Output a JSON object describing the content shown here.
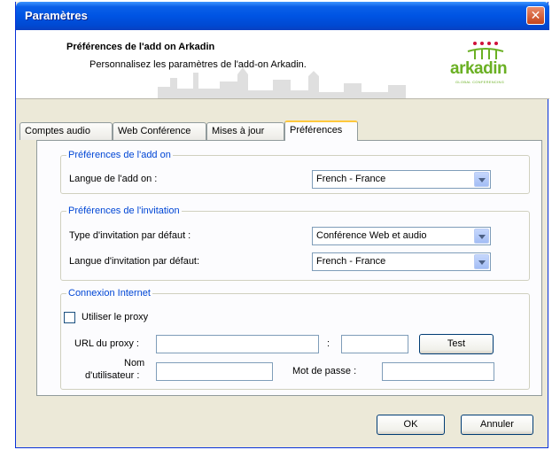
{
  "window": {
    "title": "Paramètres",
    "close_glyph": "✕"
  },
  "header": {
    "title": "Préférences de l'add on Arkadin",
    "subtitle": "Personnalisez les paramètres de l'add-on Arkadin.",
    "logo_text": "arkadin",
    "logo_tagline": "GLOBAL CONFERENCING",
    "logo_color": "#6ab023"
  },
  "tabs": [
    {
      "label": "Comptes audio"
    },
    {
      "label": "Web Conférence"
    },
    {
      "label": "Mises à jour"
    },
    {
      "label": "Préférences",
      "active": true
    }
  ],
  "addon": {
    "legend": "Préférences de l'add on",
    "language_label": "Langue de l'add on :",
    "language_value": "French - France"
  },
  "invitation": {
    "legend": "Préférences de l'invitation",
    "type_label": "Type d'invitation par défaut :",
    "type_value": "Conférence Web et audio",
    "language_label": "Langue d'invitation par défaut:",
    "language_value": "French - France"
  },
  "internet": {
    "legend": "Connexion Internet",
    "use_proxy_label": "Utiliser le proxy",
    "use_proxy_checked": false,
    "proxy_url_label": "URL du proxy :",
    "proxy_url_value": "",
    "port_separator": ":",
    "port_value": "",
    "test_button": "Test",
    "username_label_line1": "Nom",
    "username_label_line2": "d'utilisateur :",
    "username_value": "",
    "password_label": "Mot de passe :",
    "password_value": ""
  },
  "footer": {
    "ok_button": "OK",
    "cancel_button": "Annuler"
  },
  "colors": {
    "legend": "#0046d5",
    "titlebar": "#0054e3",
    "active_tab_highlight": "#ffc83c"
  }
}
